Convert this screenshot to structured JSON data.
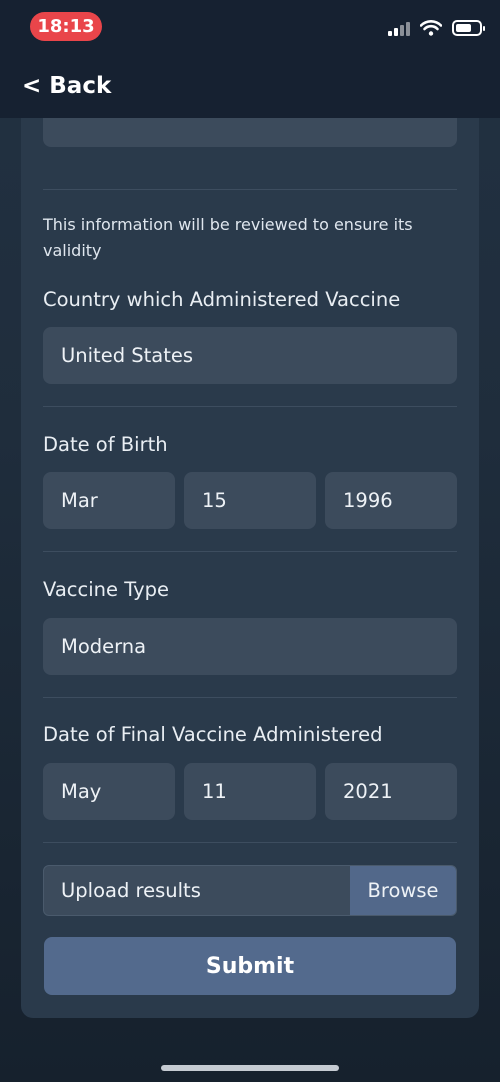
{
  "status_bar": {
    "time": "18:13",
    "icons": [
      "signal-icon",
      "wifi-icon",
      "battery-icon"
    ]
  },
  "nav": {
    "back_label": "< Back"
  },
  "form": {
    "info_text": "This information will be reviewed to ensure its validity",
    "country": {
      "label": "Country which Administered Vaccine",
      "value": "United States"
    },
    "dob": {
      "label": "Date of Birth",
      "month": "Mar",
      "day": "15",
      "year": "1996"
    },
    "vaccine_type": {
      "label": "Vaccine Type",
      "value": "Moderna"
    },
    "final_date": {
      "label": "Date of Final Vaccine Administered",
      "month": "May",
      "day": "11",
      "year": "2021"
    },
    "upload": {
      "placeholder": "Upload results",
      "browse_label": "Browse"
    },
    "submit_label": "Submit"
  },
  "colors": {
    "background": "#1f2d3c",
    "card": "#2a3a4b",
    "field": "#3c4b5c",
    "button": "#536a8d",
    "time_pill": "#e9454a"
  }
}
